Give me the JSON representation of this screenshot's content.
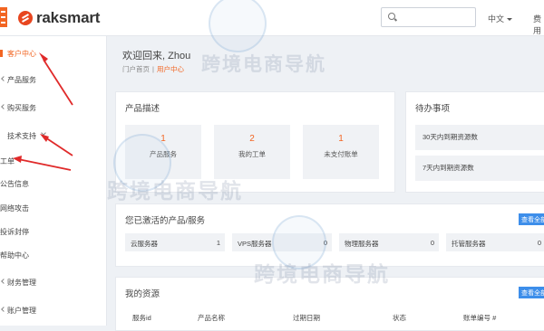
{
  "brand": {
    "name": "raksmart"
  },
  "topbar": {
    "language": "中文",
    "fee_label": "费用"
  },
  "sidebar": {
    "items": [
      {
        "label": "客户中心",
        "active": true
      },
      {
        "label": "产品服务"
      },
      {
        "label": "购买服务"
      },
      {
        "label": "技术支持"
      },
      {
        "label": "工单"
      },
      {
        "label": "公告信息"
      },
      {
        "label": "网络攻击"
      },
      {
        "label": "投诉封停"
      },
      {
        "label": "帮助中心"
      },
      {
        "label": "财务管理"
      },
      {
        "label": "账户管理"
      }
    ]
  },
  "header": {
    "welcome": "欢迎回来, Zhou",
    "breadcrumb": {
      "home": "门户首页",
      "sep": "|",
      "current": "用户中心"
    }
  },
  "product_panel": {
    "title": "产品描述",
    "stats": [
      {
        "value": "1",
        "label": "产品服务"
      },
      {
        "value": "2",
        "label": "我的工单"
      },
      {
        "value": "1",
        "label": "未支付账单"
      }
    ]
  },
  "todo_panel": {
    "title": "待办事项",
    "items": [
      "30天内到期资源数",
      "7天内到期资源数"
    ]
  },
  "active_panel": {
    "title": "您已激活的产品/服务",
    "view_all": "查看全部",
    "services": [
      {
        "name": "云服务器",
        "count": "1"
      },
      {
        "name": "VPS服务器",
        "count": "0"
      },
      {
        "name": "物理服务器",
        "count": "0"
      },
      {
        "name": "托管服务器",
        "count": "0"
      }
    ]
  },
  "resources_panel": {
    "title": "我的资源",
    "view_all": "查看全部",
    "columns": [
      "服务id",
      "产品名称",
      "过期日期",
      "状态",
      "账单编号 #"
    ]
  },
  "watermark": {
    "text": "跨境电商导航"
  },
  "colors": {
    "accent": "#f26522",
    "link_blue": "#3d8eea",
    "annotation_red": "#e02a2a"
  }
}
